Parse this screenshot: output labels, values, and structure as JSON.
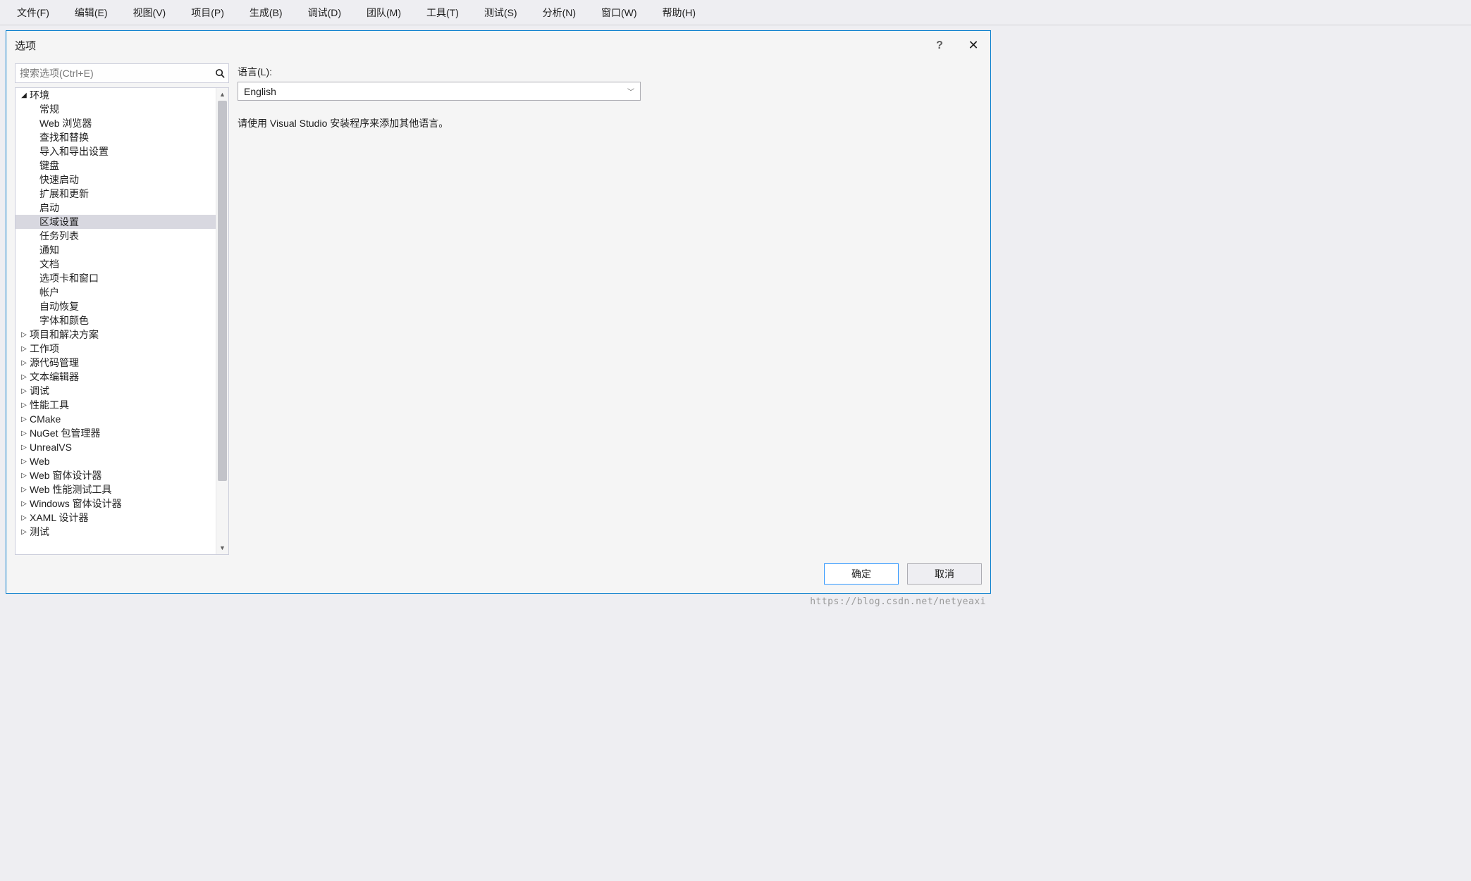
{
  "menubar": {
    "items": [
      "文件(F)",
      "编辑(E)",
      "视图(V)",
      "项目(P)",
      "生成(B)",
      "调试(D)",
      "团队(M)",
      "工具(T)",
      "测试(S)",
      "分析(N)",
      "窗口(W)",
      "帮助(H)"
    ]
  },
  "dialog": {
    "title": "选项",
    "help_icon": "?",
    "close_icon": "✕",
    "search_placeholder": "搜索选项(Ctrl+E)",
    "tree": {
      "environment_label": "环境",
      "environment_children": [
        "常规",
        "Web 浏览器",
        "查找和替换",
        "导入和导出设置",
        "键盘",
        "快速启动",
        "扩展和更新",
        "启动",
        "区域设置",
        "任务列表",
        "通知",
        "文档",
        "选项卡和窗口",
        "帐户",
        "自动恢复",
        "字体和颜色"
      ],
      "selected_child": "区域设置",
      "other_nodes": [
        "项目和解决方案",
        "工作项",
        "源代码管理",
        "文本编辑器",
        "调试",
        "性能工具",
        "CMake",
        "NuGet 包管理器",
        "UnrealVS",
        "Web",
        "Web 窗体设计器",
        "Web 性能测试工具",
        "Windows 窗体设计器",
        "XAML 设计器",
        "测试"
      ]
    },
    "right": {
      "language_label": "语言(L):",
      "language_value": "English",
      "hint": "请使用 Visual Studio 安装程序来添加其他语言。"
    },
    "buttons": {
      "ok": "确定",
      "cancel": "取消"
    }
  },
  "watermark": "https://blog.csdn.net/netyeaxi"
}
